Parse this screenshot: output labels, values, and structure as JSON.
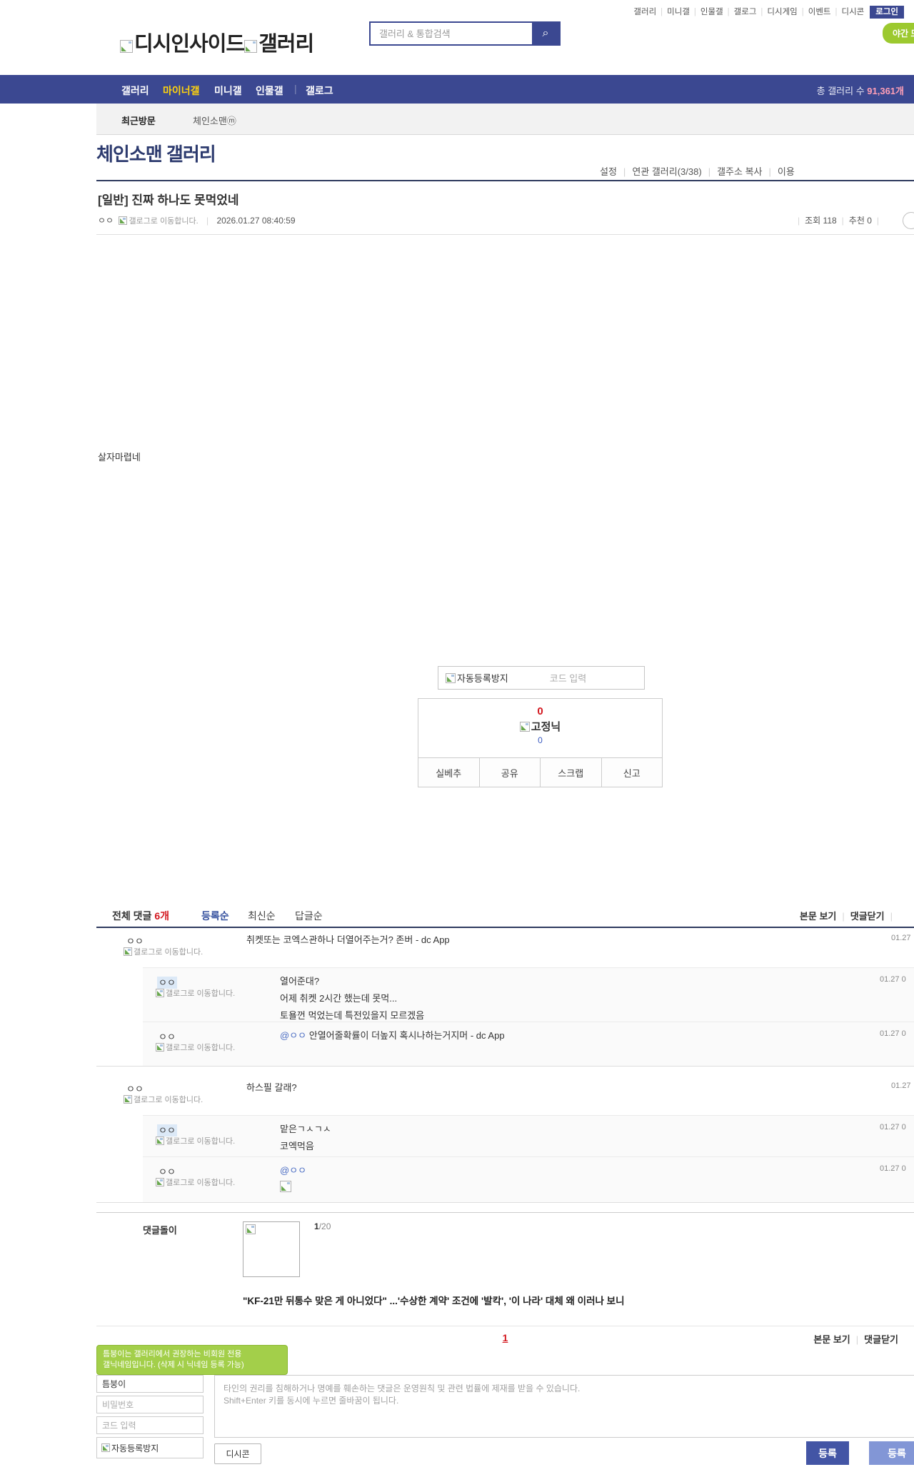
{
  "topbar": {
    "links": [
      "갤러리",
      "미니갤",
      "인물갤",
      "갤로그",
      "디시게임",
      "이벤트",
      "디시콘"
    ],
    "login": "로그인",
    "night_mode": "야간 모드"
  },
  "header": {
    "logo_dcinside": "디시인사이드",
    "logo_gallery": "갤러리",
    "search_placeholder": "갤러리 & 통합검색",
    "search_icon": "⌕"
  },
  "gnb": {
    "item1": "갤러리",
    "item2": "마이너갤",
    "item3": "미니갤",
    "item4": "인물갤",
    "item5": "갤로그",
    "total_label": "총 갤러리 수 ",
    "total_count": "91,361개"
  },
  "visit": {
    "recent": "최근방문",
    "gallery": "체인소맨ⓜ"
  },
  "gallery_head": {
    "title": "체인소맨 갤러리",
    "link1": "설정",
    "link2": "연관 갤러리(3/38)",
    "link3": "갤주소 복사",
    "link4": "이용"
  },
  "post": {
    "title": "[일반] 진짜 하나도 못먹었네",
    "writer": "ㅇㅇ",
    "gallog": "갤로그로 이동합니다.",
    "date": "2026.01.27 08:40:59",
    "views": "조회 118",
    "likes": "추천 0",
    "body": "살자마렵네"
  },
  "captcha": {
    "label": "자동등록방지",
    "placeholder": "코드 입력"
  },
  "vote": {
    "up": "0",
    "nick": "고정닉",
    "down": "0",
    "btn1": "실베추",
    "btn2": "공유",
    "btn3": "스크랩",
    "btn4": "신고"
  },
  "comments": {
    "total_label": "전체 댓글 ",
    "count": "6개",
    "sort1": "등록순",
    "sort2": "최신순",
    "sort3": "답글순",
    "view_post": "본문 보기",
    "close_comments": "댓글닫기",
    "items": [
      {
        "writer": "ㅇㅇ",
        "gallog": "갤로그로 이동합니다.",
        "line1": "취켓또는 코엑스관하나 더열어주는거? 존버 - dc App",
        "time": "01.27"
      },
      {
        "writer": "ㅇㅇ",
        "gallog": "갤로그로 이동합니다.",
        "line1": "열어준대?",
        "line2": "어제 취켓 2시간 했는데 못먹...",
        "line3": "토욜껀 먹었는데 특전있을지 모르겠음",
        "time": "01.27 0"
      },
      {
        "writer": "ㅇㅇ",
        "gallog": "갤로그로 이동합니다.",
        "mention": "@ㅇㅇ",
        "line1": " 안열어줄확률이 더높지 혹시나하는거지머 - dc App",
        "time": "01.27 0"
      },
      {
        "writer": "ㅇㅇ",
        "gallog": "갤로그로 이동합니다.",
        "line1": "하스필 갈래?",
        "time": "01.27"
      },
      {
        "writer": "ㅇㅇ",
        "gallog": "갤로그로 이동합니다.",
        "line1": "맡은ㄱㅅㄱㅅ",
        "line2": "코엑먹음",
        "time": "01.27 0"
      },
      {
        "writer": "ㅇㅇ",
        "gallog": "갤로그로 이동합니다.",
        "mention": "@ㅇㅇ",
        "time": "01.27 0"
      }
    ],
    "bot": {
      "label": "댓글돌이",
      "page_current": "1",
      "page_total": "/20",
      "headline": "\"KF-21만 뒤통수 맞은 게 아니었다\" ...'수상한 계약' 조건에 '발칵', '이 나라' 대체 왜 이러나 보니"
    },
    "pagination": "1"
  },
  "write_form": {
    "tooltip_line1": "틈붕이는 갤러리에서 권장하는 비회원 전용",
    "tooltip_line2": "갤닉네임입니다. (삭제 시 닉네임 등록 가능)",
    "nickname_value": "틈붕이",
    "password_placeholder": "비밀번호",
    "code_placeholder": "코드 입력",
    "captcha_label": "자동등록방지",
    "hint_line1": "타인의 권리를 침해하거나 명예를 훼손하는 댓글은 운영원칙 및 관련 법률에 제재를 받을 수 있습니다.",
    "hint_line2": "Shift+Enter 키를 동시에 누르면 줄바꿈이 됩니다.",
    "dccon": "디시콘",
    "submit": "등록",
    "submit2": "등록"
  }
}
